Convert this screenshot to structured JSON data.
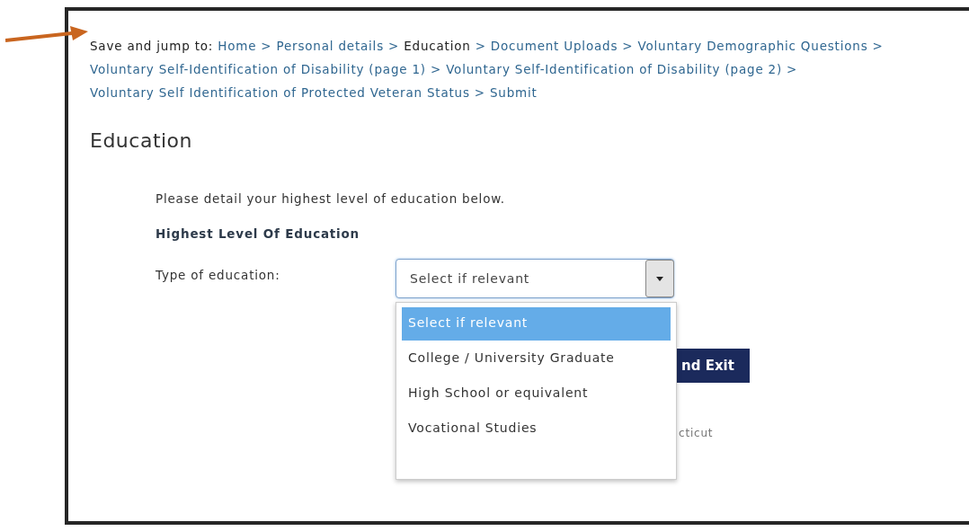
{
  "breadcrumb": {
    "label": "Save and jump to:",
    "items": [
      {
        "text": "Home",
        "current": false,
        "separator": ">"
      },
      {
        "text": "Personal details",
        "current": false,
        "separator": ">"
      },
      {
        "text": "Education",
        "current": true,
        "separator": ">"
      },
      {
        "text": "Document Uploads",
        "current": false,
        "separator": ">"
      },
      {
        "text": "Voluntary Demographic Questions",
        "current": false,
        "separator": ">"
      },
      {
        "text": "Voluntary Self-Identification of Disability (page 1)",
        "current": false,
        "separator": ">"
      },
      {
        "text": "Voluntary Self-Identification of Disability (page 2)",
        "current": false,
        "separator": ">"
      },
      {
        "text": "Voluntary Self Identification of Protected Veteran Status",
        "current": false,
        "separator": ">"
      },
      {
        "text": "Submit",
        "current": false
      }
    ]
  },
  "page_title": "Education",
  "intro": "Please detail your highest level of education below.",
  "section_heading": "Highest Level Of Education",
  "field": {
    "label": "Type of education:",
    "value": "Select if relevant",
    "expanded": true,
    "options": [
      {
        "text": "Select if relevant",
        "selected": true
      },
      {
        "text": "College / University Graduate",
        "selected": false
      },
      {
        "text": "High School or equivalent",
        "selected": false
      },
      {
        "text": "Vocational Studies",
        "selected": false
      }
    ]
  },
  "button": "nd Exit",
  "footnote": "cticut"
}
